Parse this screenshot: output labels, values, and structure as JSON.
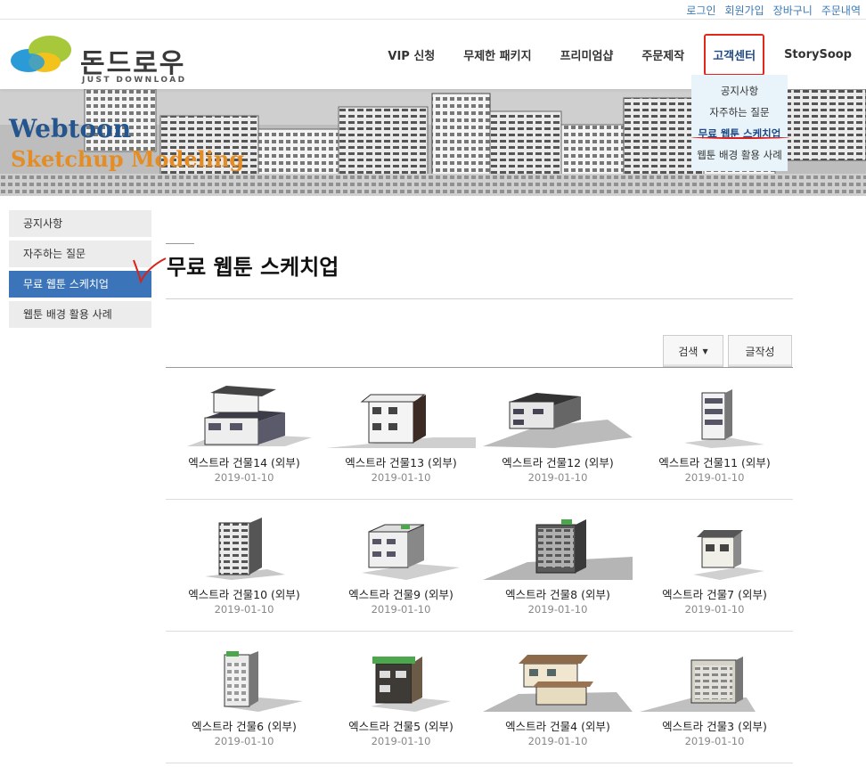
{
  "util_links": [
    "로그인",
    "회원가입",
    "장바구니",
    "주문내역"
  ],
  "logo": {
    "name": "돈드로우",
    "tagline": "JUST DOWNLOAD"
  },
  "nav": [
    "VIP 신청",
    "무제한 패키지",
    "프리미엄샵",
    "주문제작",
    "고객센터",
    "StorySoop"
  ],
  "dropdown": [
    "공지사항",
    "자주하는 질문",
    "무료 웹툰 스케치업",
    "웹툰 배경 활용 사례"
  ],
  "banner": {
    "line1": "Webtoon",
    "line2": "Sketchup Modeling"
  },
  "sidebar": [
    {
      "label": "공지사항"
    },
    {
      "label": "자주하는 질문"
    },
    {
      "label": "무료 웹툰 스케치업"
    },
    {
      "label": "웹툰 배경 활용 사례"
    }
  ],
  "page_title": "무료 웹툰 스케치업",
  "buttons": {
    "search": "검색",
    "write": "글작성"
  },
  "items": [
    {
      "title": "엑스트라 건물14 (외부)",
      "date": "2019-01-10"
    },
    {
      "title": "엑스트라 건물13 (외부)",
      "date": "2019-01-10"
    },
    {
      "title": "엑스트라 건물12 (외부)",
      "date": "2019-01-10"
    },
    {
      "title": "엑스트라 건물11 (외부)",
      "date": "2019-01-10"
    },
    {
      "title": "엑스트라 건물10 (외부)",
      "date": "2019-01-10"
    },
    {
      "title": "엑스트라 건물9 (외부)",
      "date": "2019-01-10"
    },
    {
      "title": "엑스트라 건물8 (외부)",
      "date": "2019-01-10"
    },
    {
      "title": "엑스트라 건물7 (외부)",
      "date": "2019-01-10"
    },
    {
      "title": "엑스트라 건물6 (외부)",
      "date": "2019-01-10"
    },
    {
      "title": "엑스트라 건물5 (외부)",
      "date": "2019-01-10"
    },
    {
      "title": "엑스트라 건물4 (외부)",
      "date": "2019-01-10"
    },
    {
      "title": "엑스트라 건물3 (외부)",
      "date": "2019-01-10"
    }
  ]
}
